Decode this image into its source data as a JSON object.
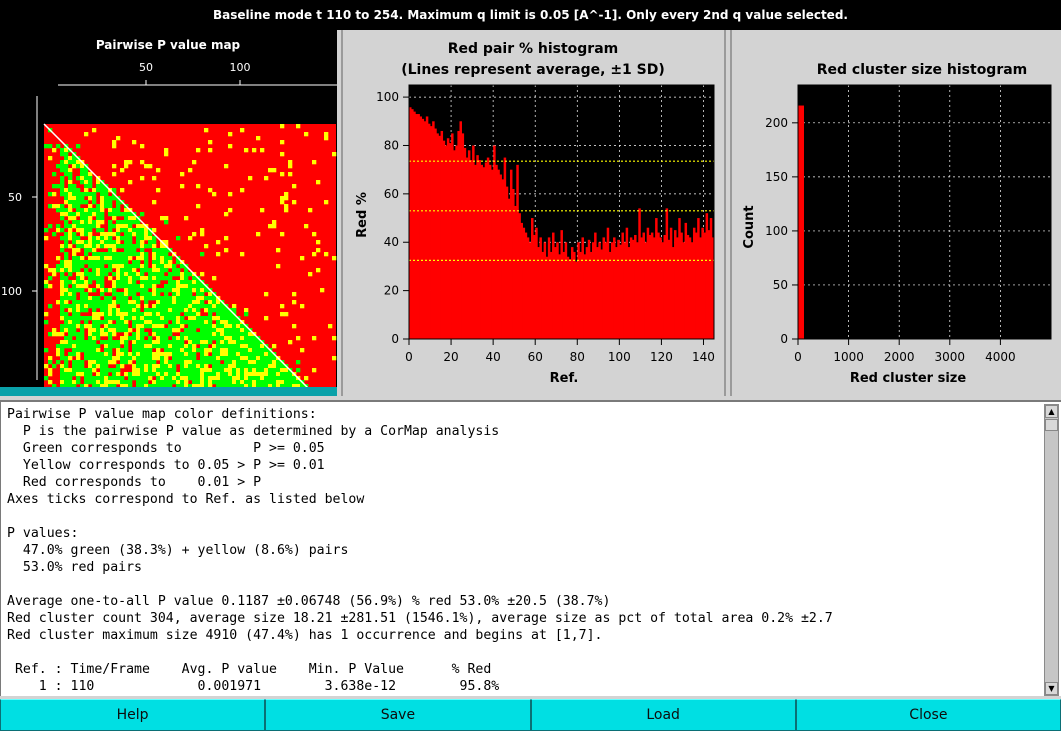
{
  "title": "Baseline mode t 110 to 254. Maximum q limit is 0.05 [A^-1]. Only every 2nd q value selected.",
  "map": {
    "title": "Pairwise P value map",
    "x_ticks": [
      "50",
      "100"
    ],
    "y_ticks": [
      "50",
      "100"
    ]
  },
  "colors": {
    "red": "#ff0000",
    "green": "#00ff00",
    "yellow": "#ffff00",
    "black": "#000000",
    "cyan": "#00dfe3"
  },
  "chart_data": [
    {
      "type": "bar",
      "title": "Red pair % histogram",
      "subtitle": "(Lines represent average, ±1 SD)",
      "xlabel": "Ref.",
      "ylabel": "Red %",
      "xlim": [
        0,
        145
      ],
      "ylim": [
        0,
        105
      ],
      "x_ticks": [
        0,
        20,
        40,
        60,
        80,
        100,
        120,
        140
      ],
      "y_ticks": [
        0,
        20,
        40,
        60,
        80,
        100
      ],
      "grid": true,
      "reference_lines": [
        73.5,
        53.0,
        32.5
      ],
      "values": [
        95.8,
        95,
        94,
        93,
        93,
        92,
        91,
        90,
        92,
        89,
        88,
        90,
        87,
        85,
        84,
        86,
        82,
        80,
        83,
        81,
        85,
        78,
        80,
        86,
        90,
        85,
        79,
        75,
        78,
        74,
        80,
        72,
        76,
        74,
        72,
        71,
        73,
        75,
        72,
        70,
        80,
        72,
        70,
        68,
        66,
        75,
        63,
        58,
        70,
        62,
        55,
        72,
        52,
        48,
        46,
        44,
        42,
        40,
        50,
        43,
        46,
        38,
        42,
        36,
        40,
        34,
        42,
        36,
        44,
        38,
        40,
        35,
        45,
        36,
        40,
        34,
        33,
        38,
        36,
        32,
        40,
        36,
        42,
        35,
        38,
        41,
        36,
        40,
        44,
        38,
        40,
        37,
        42,
        40,
        46,
        36,
        40,
        42,
        38,
        41,
        39,
        44,
        40,
        46,
        38,
        42,
        41,
        43,
        40,
        54,
        42,
        44,
        40,
        46,
        43,
        44,
        42,
        50,
        44,
        42,
        40,
        43,
        54,
        41,
        46,
        38,
        45,
        42,
        50,
        44,
        40,
        48,
        43,
        42,
        40,
        46,
        44,
        50,
        42,
        46,
        44,
        52,
        45,
        50,
        42
      ]
    },
    {
      "type": "bar",
      "title": "Red cluster size histogram",
      "xlabel": "Red cluster size",
      "ylabel": "Count",
      "xlim": [
        0,
        5000
      ],
      "ylim": [
        0,
        235
      ],
      "x_ticks": [
        0,
        1000,
        2000,
        3000,
        4000
      ],
      "y_ticks": [
        0,
        50,
        100,
        150,
        200
      ],
      "grid": true,
      "bars": [
        {
          "x": 0,
          "value": 216
        }
      ]
    }
  ],
  "text_lines": [
    "Pairwise P value map color definitions:",
    "  P is the pairwise P value as determined by a CorMap analysis",
    "  Green corresponds to         P >= 0.05",
    "  Yellow corresponds to 0.05 > P >= 0.01",
    "  Red corresponds to    0.01 > P",
    "Axes ticks correspond to Ref. as listed below",
    "",
    "P values:",
    "  47.0% green (38.3%) + yellow (8.6%) pairs",
    "  53.0% red pairs",
    "",
    "Average one-to-all P value 0.1187 ±0.06748 (56.9%) % red 53.0% ±20.5 (38.7%)",
    "Red cluster count 304, average size 18.21 ±281.51 (1546.1%), average size as pct of total area 0.2% ±2.7",
    "Red cluster maximum size 4910 (47.4%) has 1 occurrence and begins at [1,7].",
    "",
    " Ref. : Time/Frame    Avg. P value    Min. P Value      % Red",
    "    1 : 110             0.001971        3.638e-12        95.8%"
  ],
  "buttons": {
    "help": "Help",
    "save": "Save",
    "load": "Load",
    "close": "Close"
  }
}
